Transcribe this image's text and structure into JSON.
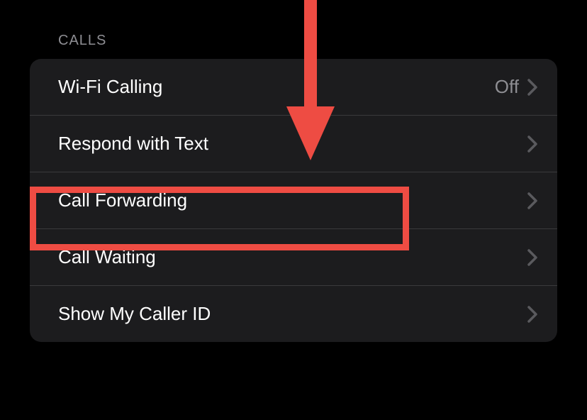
{
  "section": {
    "header": "CALLS",
    "items": [
      {
        "label": "Wi-Fi Calling",
        "value": "Off"
      },
      {
        "label": "Respond with Text",
        "value": ""
      },
      {
        "label": "Call Forwarding",
        "value": ""
      },
      {
        "label": "Call Waiting",
        "value": ""
      },
      {
        "label": "Show My Caller ID",
        "value": ""
      }
    ]
  },
  "annotation": {
    "highlight_color": "#ee4c43"
  }
}
